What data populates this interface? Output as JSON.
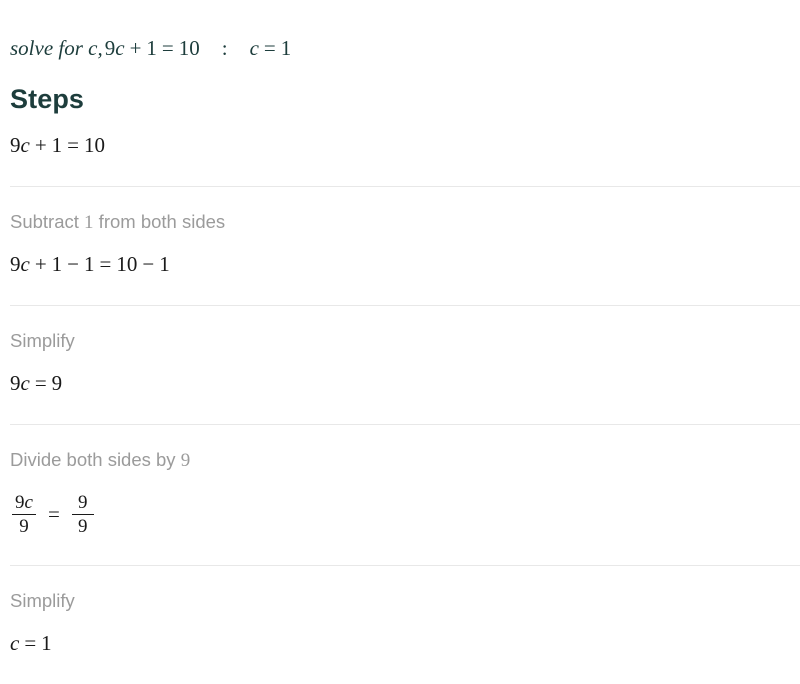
{
  "query": {
    "prompt": "solve for c,",
    "expression": "9c + 1 = 10",
    "separator": ":",
    "answer": "c = 1"
  },
  "heading": "Steps",
  "steps": [
    {
      "label": "",
      "math": "9c + 1 = 10"
    },
    {
      "label": "Subtract 1 from both sides",
      "math": "9c + 1 − 1 = 10 − 1"
    },
    {
      "label": "Simplify",
      "math": "9c = 9"
    },
    {
      "label": "Divide both sides by 9",
      "math": "9c/9 = 9/9",
      "fraction": {
        "left_numerator": "9c",
        "left_denominator": "9",
        "operator": "=",
        "right_numerator": "9",
        "right_denominator": "9"
      }
    },
    {
      "label": "Simplify",
      "math": "c = 1"
    }
  ],
  "colors": {
    "accent": "#1d3d3c",
    "label": "#9b9b9b",
    "math": "#1a1a1a",
    "divider": "#e8e8e8",
    "background": "#ffffff"
  }
}
